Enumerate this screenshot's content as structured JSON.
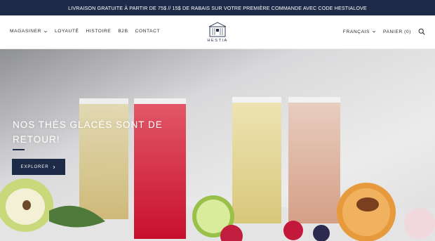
{
  "announcement": "LIVRAISON GRATUITE À PARTIR DE 75$ // 15$ DE RABAIS SUR VOTRE PREMIÈRE COMMANDE AVEC CODE HESTIALOVE",
  "nav": {
    "shop": "MAGASINER",
    "loyalty": "LOYAUTÉ",
    "history": "HISTOIRE",
    "b2b": "B2B",
    "contact": "CONTACT"
  },
  "logo": {
    "text": "HESTIA"
  },
  "header_right": {
    "language": "FRANÇAIS",
    "cart": "PANIER (0)"
  },
  "hero": {
    "title_line1": "NOS THÉS GLACÉS SONT DE",
    "title_line2": "RETOUR!",
    "cta": "EXPLORER"
  },
  "colors": {
    "navy": "#1d2a48",
    "white": "#ffffff"
  },
  "icons": [
    "chevron-down-icon",
    "search-icon",
    "chevron-right-icon"
  ]
}
